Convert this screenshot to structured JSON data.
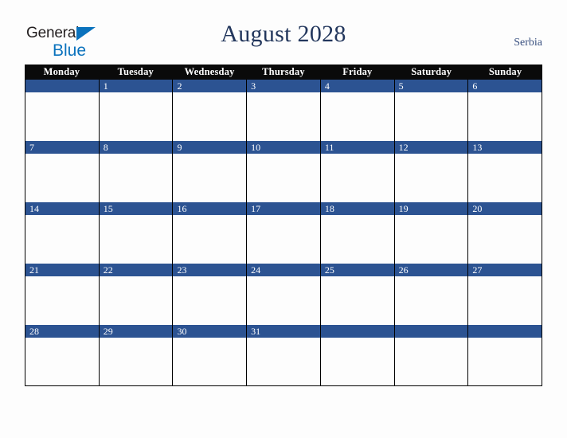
{
  "brand": {
    "name_part1": "General",
    "name_part2": "Blue",
    "triangle_icon": "logo-triangle-icon",
    "dark_color": "#231f20",
    "blue_color": "#0a72bd"
  },
  "header": {
    "title": "August 2028",
    "month": "August",
    "year": "2028",
    "country": "Serbia",
    "title_color": "#22365c",
    "country_color": "#3a5180"
  },
  "calendar": {
    "weekday_header_bg": "#0a0a0a",
    "weekday_header_color": "#ffffff",
    "date_band_color": "#2c5392",
    "date_number_color": "#ffffff",
    "cell_bg": "#fdfdfd",
    "border_color": "#000000",
    "weekdays": [
      "Monday",
      "Tuesday",
      "Wednesday",
      "Thursday",
      "Friday",
      "Saturday",
      "Sunday"
    ],
    "weeks": [
      [
        "",
        "1",
        "2",
        "3",
        "4",
        "5",
        "6"
      ],
      [
        "7",
        "8",
        "9",
        "10",
        "11",
        "12",
        "13"
      ],
      [
        "14",
        "15",
        "16",
        "17",
        "18",
        "19",
        "20"
      ],
      [
        "21",
        "22",
        "23",
        "24",
        "25",
        "26",
        "27"
      ],
      [
        "28",
        "29",
        "30",
        "31",
        "",
        "",
        ""
      ]
    ]
  }
}
